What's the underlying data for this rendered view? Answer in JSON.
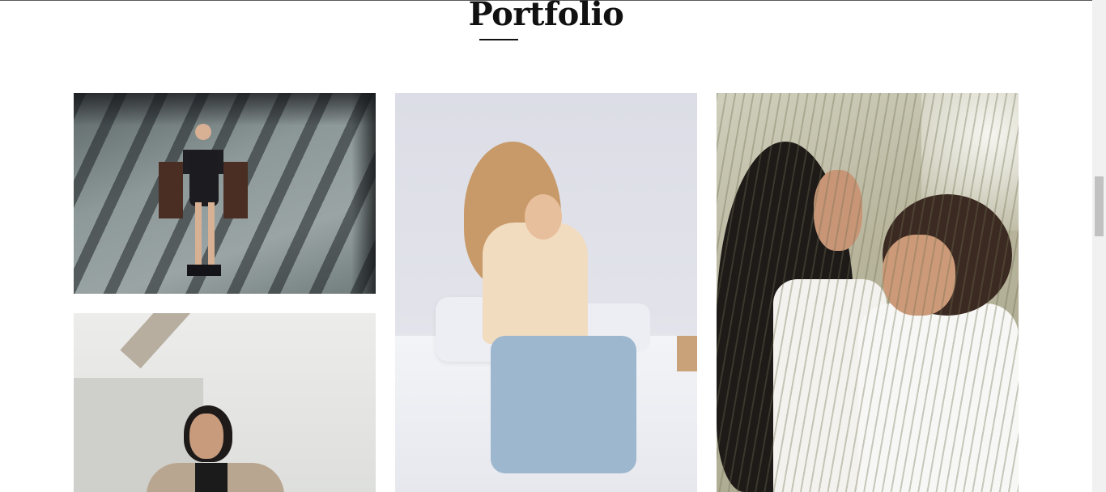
{
  "page": {
    "title": "Portfolio"
  },
  "portfolio": {
    "items": [
      {
        "subject": "woman-posing-on-chairs"
      },
      {
        "subject": "woman-on-bed"
      },
      {
        "subject": "couple-in-grass"
      },
      {
        "subject": "woman-against-wall"
      }
    ]
  },
  "scrollbar": {
    "scroll_position": 0.36
  },
  "colors": {
    "background": "#ffffff",
    "title": "#111111",
    "scrollbar_thumb": "#c1c1c1"
  }
}
